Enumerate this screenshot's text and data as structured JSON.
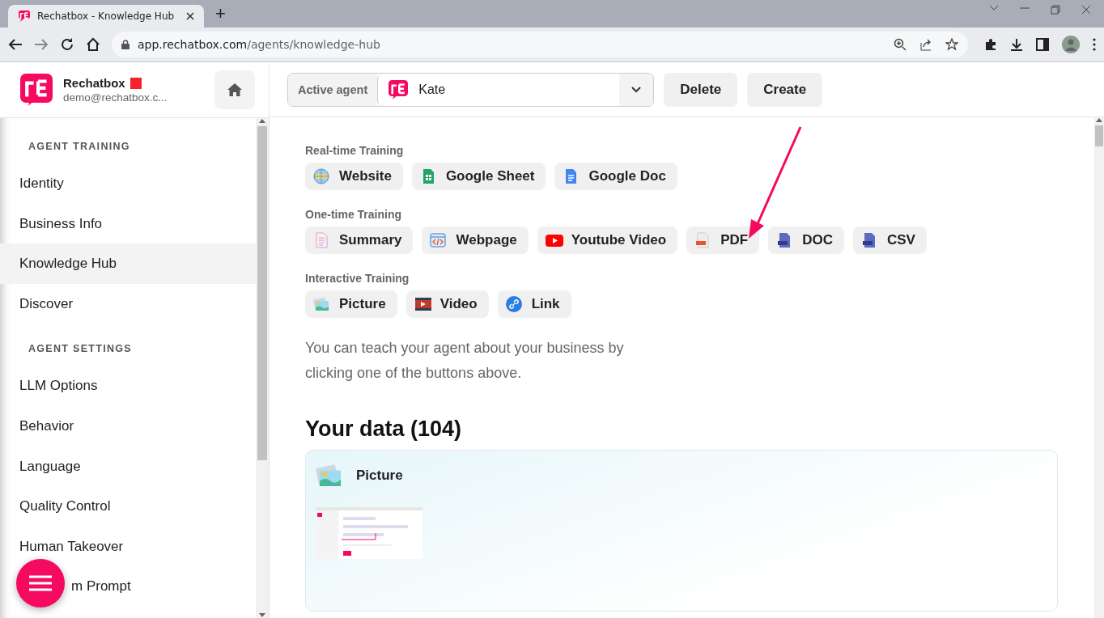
{
  "browser": {
    "tab_title": "Rechatbox - Knowledge Hub",
    "new_tab": "+",
    "url_host": "app.rechatbox.com",
    "url_path": "/agents/knowledge-hub"
  },
  "sidebar": {
    "brand": "Rechatbox",
    "email": "demo@rechatbox.c...",
    "sections": [
      {
        "heading": "AGENT TRAINING",
        "items": [
          {
            "label": "Identity",
            "selected": false
          },
          {
            "label": "Business Info",
            "selected": false
          },
          {
            "label": "Knowledge Hub",
            "selected": true
          },
          {
            "label": "Discover",
            "selected": false
          }
        ]
      },
      {
        "heading": "AGENT SETTINGS",
        "items": [
          {
            "label": "LLM Options",
            "selected": false
          },
          {
            "label": "Behavior",
            "selected": false
          },
          {
            "label": "Language",
            "selected": false
          },
          {
            "label": "Quality Control",
            "selected": false
          },
          {
            "label": "Human Takeover",
            "selected": false
          },
          {
            "label": "m Prompt",
            "selected": false
          }
        ]
      }
    ]
  },
  "agent_bar": {
    "label": "Active agent",
    "agent": "Kate",
    "buttons": [
      "Delete",
      "Create"
    ]
  },
  "training": [
    {
      "title": "Real-time Training",
      "buttons": [
        {
          "label": "Website",
          "kind": "globe"
        },
        {
          "label": "Google Sheet",
          "kind": "sheet"
        },
        {
          "label": "Google Doc",
          "kind": "doc"
        }
      ]
    },
    {
      "title": "One-time Training",
      "buttons": [
        {
          "label": "Summary",
          "kind": "summary"
        },
        {
          "label": "Webpage",
          "kind": "code"
        },
        {
          "label": "Youtube Video",
          "kind": "youtube"
        },
        {
          "label": "PDF",
          "kind": "pdf"
        },
        {
          "label": "DOC",
          "kind": "docx"
        },
        {
          "label": "CSV",
          "kind": "csv"
        }
      ]
    },
    {
      "title": "Interactive Training",
      "buttons": [
        {
          "label": "Picture",
          "kind": "picture"
        },
        {
          "label": "Video",
          "kind": "film"
        },
        {
          "label": "Link",
          "kind": "link"
        }
      ]
    }
  ],
  "hint": "You can teach your agent about your business by clicking one of the buttons above.",
  "data": {
    "title": "Your data (104)",
    "cards": [
      {
        "title": "Picture",
        "kind": "picture"
      }
    ]
  }
}
